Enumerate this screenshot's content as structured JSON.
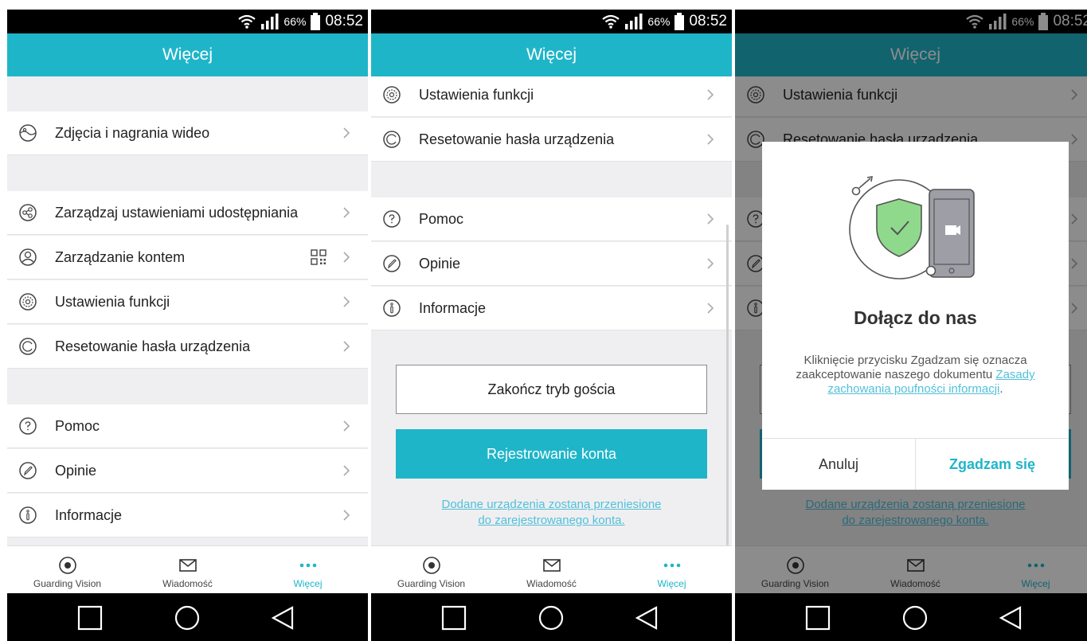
{
  "status": {
    "battery": "66%",
    "time": "08:52"
  },
  "header": {
    "title": "Więcej"
  },
  "menu": {
    "photos": "Zdjęcia i nagrania wideo",
    "sharing": "Zarządzaj ustawieniami udostępniania",
    "account": "Zarządzanie kontem",
    "features": "Ustawienia funkcji",
    "reset": "Resetowanie hasła urządzenia",
    "help": "Pomoc",
    "feedback": "Opinie",
    "info": "Informacje"
  },
  "guest": {
    "end_label": "Zakończ tryb gościa",
    "register_label": "Rejestrowanie konta",
    "migrate_line1": "Dodane urządzenia zostaną przeniesione",
    "migrate_line2": "do zarejestrowanego konta."
  },
  "nav": {
    "tab1": "Guarding Vision",
    "tab2": "Wiadomość",
    "tab3": "Więcej"
  },
  "dialog": {
    "title": "Dołącz do nas",
    "body": "Kliknięcie przycisku Zgadzam się oznacza zaakceptowanie naszego dokumentu ",
    "link": "Zasady zachowania poufności informacji",
    "suffix": ".",
    "cancel": "Anuluj",
    "accept": "Zgadzam się"
  },
  "colors": {
    "accent": "#1fb5c9",
    "link": "#52c0da",
    "shield": "#8fd98c"
  }
}
